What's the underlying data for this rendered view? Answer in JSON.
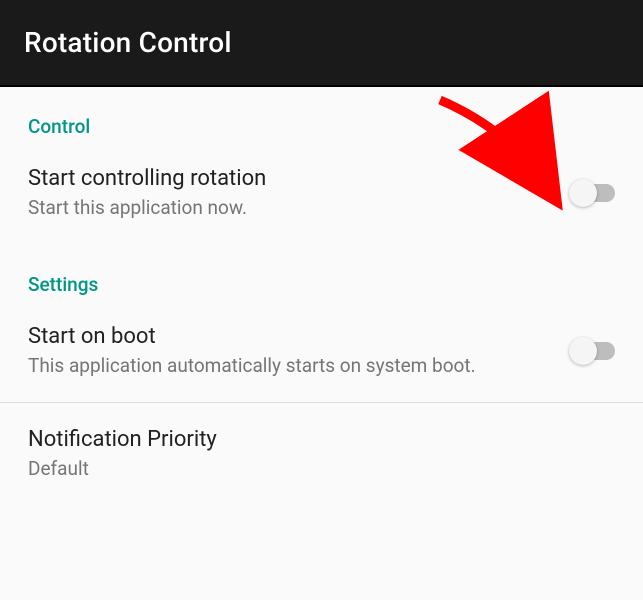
{
  "appBar": {
    "title": "Rotation Control"
  },
  "sections": {
    "control": {
      "header": "Control",
      "startRotation": {
        "title": "Start controlling rotation",
        "summary": "Start this application now."
      }
    },
    "settings": {
      "header": "Settings",
      "startOnBoot": {
        "title": "Start on boot",
        "summary": "This application automatically starts on system boot."
      },
      "notificationPriority": {
        "title": "Notification Priority",
        "summary": "Default"
      }
    }
  }
}
